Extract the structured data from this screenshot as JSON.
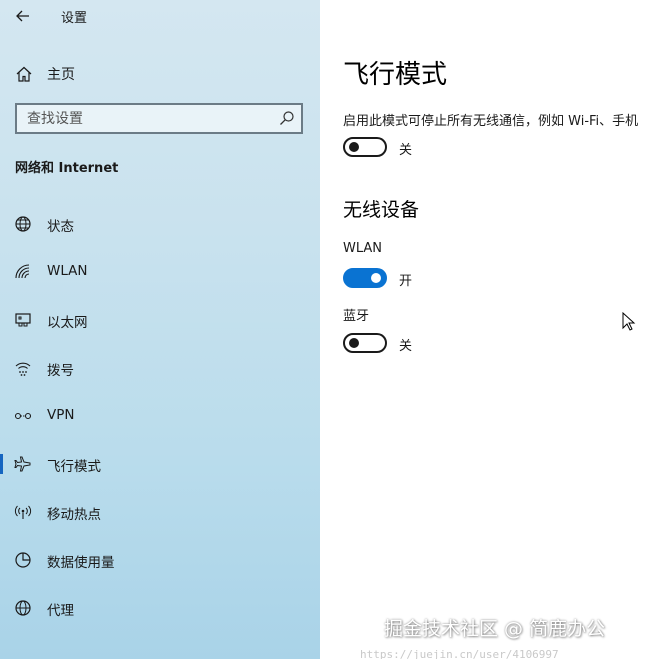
{
  "window": {
    "title": "设置"
  },
  "sidebar": {
    "home_label": "主页",
    "search_placeholder": "查找设置",
    "section_title": "网络和 Internet",
    "items": [
      {
        "label": "状态",
        "icon": "globe-status-icon"
      },
      {
        "label": "WLAN",
        "icon": "wifi-icon"
      },
      {
        "label": "以太网",
        "icon": "ethernet-icon"
      },
      {
        "label": "拨号",
        "icon": "dialup-icon"
      },
      {
        "label": "VPN",
        "icon": "vpn-icon"
      },
      {
        "label": "飞行模式",
        "icon": "airplane-icon",
        "selected": true
      },
      {
        "label": "移动热点",
        "icon": "hotspot-icon"
      },
      {
        "label": "数据使用量",
        "icon": "data-usage-icon"
      },
      {
        "label": "代理",
        "icon": "globe-proxy-icon"
      }
    ]
  },
  "main": {
    "title": "飞行模式",
    "description": "启用此模式可停止所有无线通信，例如 Wi-Fi、手机",
    "airplane_toggle": {
      "state": "off",
      "label": "关"
    },
    "wireless_section_title": "无线设备",
    "devices": [
      {
        "name": "WLAN",
        "state": "on",
        "label": "开"
      },
      {
        "name": "蓝牙",
        "state": "off",
        "label": "关"
      }
    ]
  },
  "overlay": {
    "watermark": "掘金技术社区 @ 简鹿办公",
    "url_strip": "https://juejin.cn/user/4106997"
  },
  "colors": {
    "accent": "#0a73d2",
    "sidebar_bg": "#c9e2ee",
    "active_indicator": "#1565c0"
  }
}
